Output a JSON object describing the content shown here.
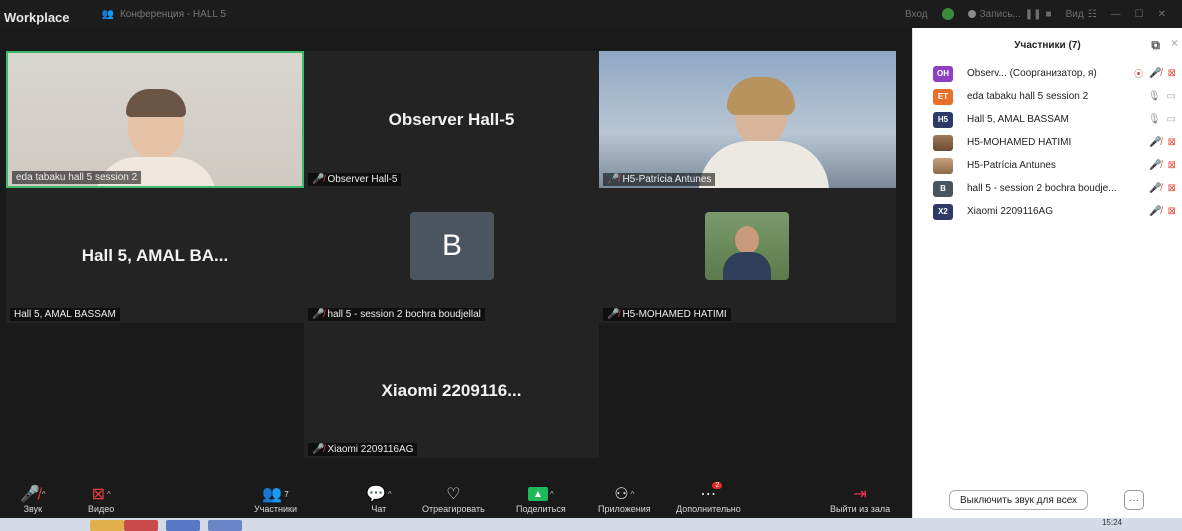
{
  "titlebar": {
    "brand": "Workplace",
    "meeting_title": "Конференция - HALL 5",
    "signin": "Вход",
    "record_label": "Запись...",
    "view_label": "Вид"
  },
  "tiles": [
    {
      "label": "eda tabaku hall 5 session 2",
      "big_name": ""
    },
    {
      "label": "Observer  Hall-5",
      "big_name": "Observer  Hall-5"
    },
    {
      "label": "H5-Patrícia Antunes",
      "big_name": ""
    },
    {
      "label": "Hall 5, AMAL BASSAM",
      "big_name": "Hall 5, AMAL BA..."
    },
    {
      "label": "hall 5 - session 2 bochra boudjellal",
      "avatar_letter": "B"
    },
    {
      "label": "H5-MOHAMED HATIMI"
    },
    {
      "label": "Xiaomi 2209116AG",
      "big_name": "Xiaomi 2209116..."
    }
  ],
  "toolbar": {
    "audio": "Звук",
    "video": "Видео",
    "participants": "Участники",
    "participants_count": "7",
    "chat": "Чат",
    "react": "Отреагировать",
    "share": "Поделиться",
    "apps": "Приложения",
    "more": "Дополнительно",
    "more_badge": "2",
    "leave": "Выйти из зала"
  },
  "panel": {
    "title": "Участники (7)",
    "participants": [
      {
        "initials": "OH",
        "color": "#8e3fc2",
        "name": "Observ...  (Соорганизатор, я)",
        "rec": true,
        "muted": true,
        "video_off": true
      },
      {
        "initials": "ET",
        "color": "#e8702a",
        "name": "eda tabaku hall 5 session 2",
        "muted": false,
        "video_off": false
      },
      {
        "initials": "H5",
        "color": "#2d3a66",
        "name": "Hall 5, AMAL BASSAM",
        "muted": false,
        "video_off": false
      },
      {
        "initials": "",
        "color": "photo",
        "name": "H5-MOHAMED HATIMI",
        "muted": true,
        "video_off": true
      },
      {
        "initials": "",
        "color": "photo",
        "name": "H5-Patrícia Antunes",
        "muted": true,
        "video_off": true
      },
      {
        "initials": "B",
        "color": "#4b5560",
        "name": "hall 5 - session 2 bochra boudje...",
        "muted": true,
        "video_off": true
      },
      {
        "initials": "X2",
        "color": "#2d3a66",
        "name": "Xiaomi 2209116AG",
        "muted": true,
        "video_off": true
      }
    ],
    "mute_all": "Выключить звук для всех",
    "more_button": "···"
  },
  "taskbar": {
    "time": "15:24"
  }
}
